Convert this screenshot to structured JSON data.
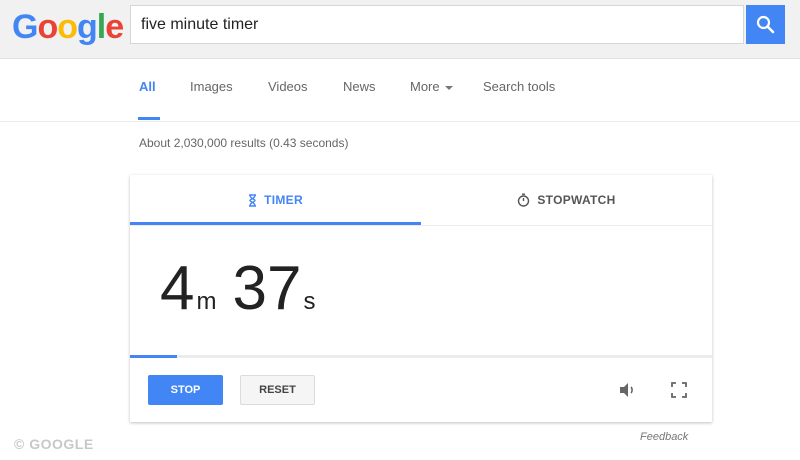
{
  "header": {
    "logo": [
      "G",
      "o",
      "o",
      "g",
      "l",
      "e"
    ],
    "logo_colors": [
      "#4285f4",
      "#ea4335",
      "#fbbc05",
      "#4285f4",
      "#34a853",
      "#ea4335"
    ],
    "search_value": "five minute timer",
    "search_icon": "search-icon"
  },
  "nav": {
    "tabs": [
      "All",
      "Images",
      "Videos",
      "News",
      "More",
      "Search tools"
    ],
    "active": "All",
    "accent_color": "#4285f4"
  },
  "results": {
    "stats": "About 2,030,000 results (0.43 seconds)"
  },
  "timer_card": {
    "tabs": {
      "timer": "TIMER",
      "stopwatch": "STOPWATCH"
    },
    "timer_icon": "hourglass-icon",
    "stopwatch_icon": "stopwatch-icon",
    "time": {
      "minutes": "4",
      "minutes_unit": "m",
      "seconds": "37",
      "seconds_unit": "s"
    },
    "progress_fraction": 0.08,
    "buttons": {
      "stop": "STOP",
      "reset": "RESET"
    },
    "sound_icon": "speaker-icon",
    "fullscreen_icon": "fullscreen-icon"
  },
  "feedback": "Feedback",
  "watermark": "© GOOGLE"
}
